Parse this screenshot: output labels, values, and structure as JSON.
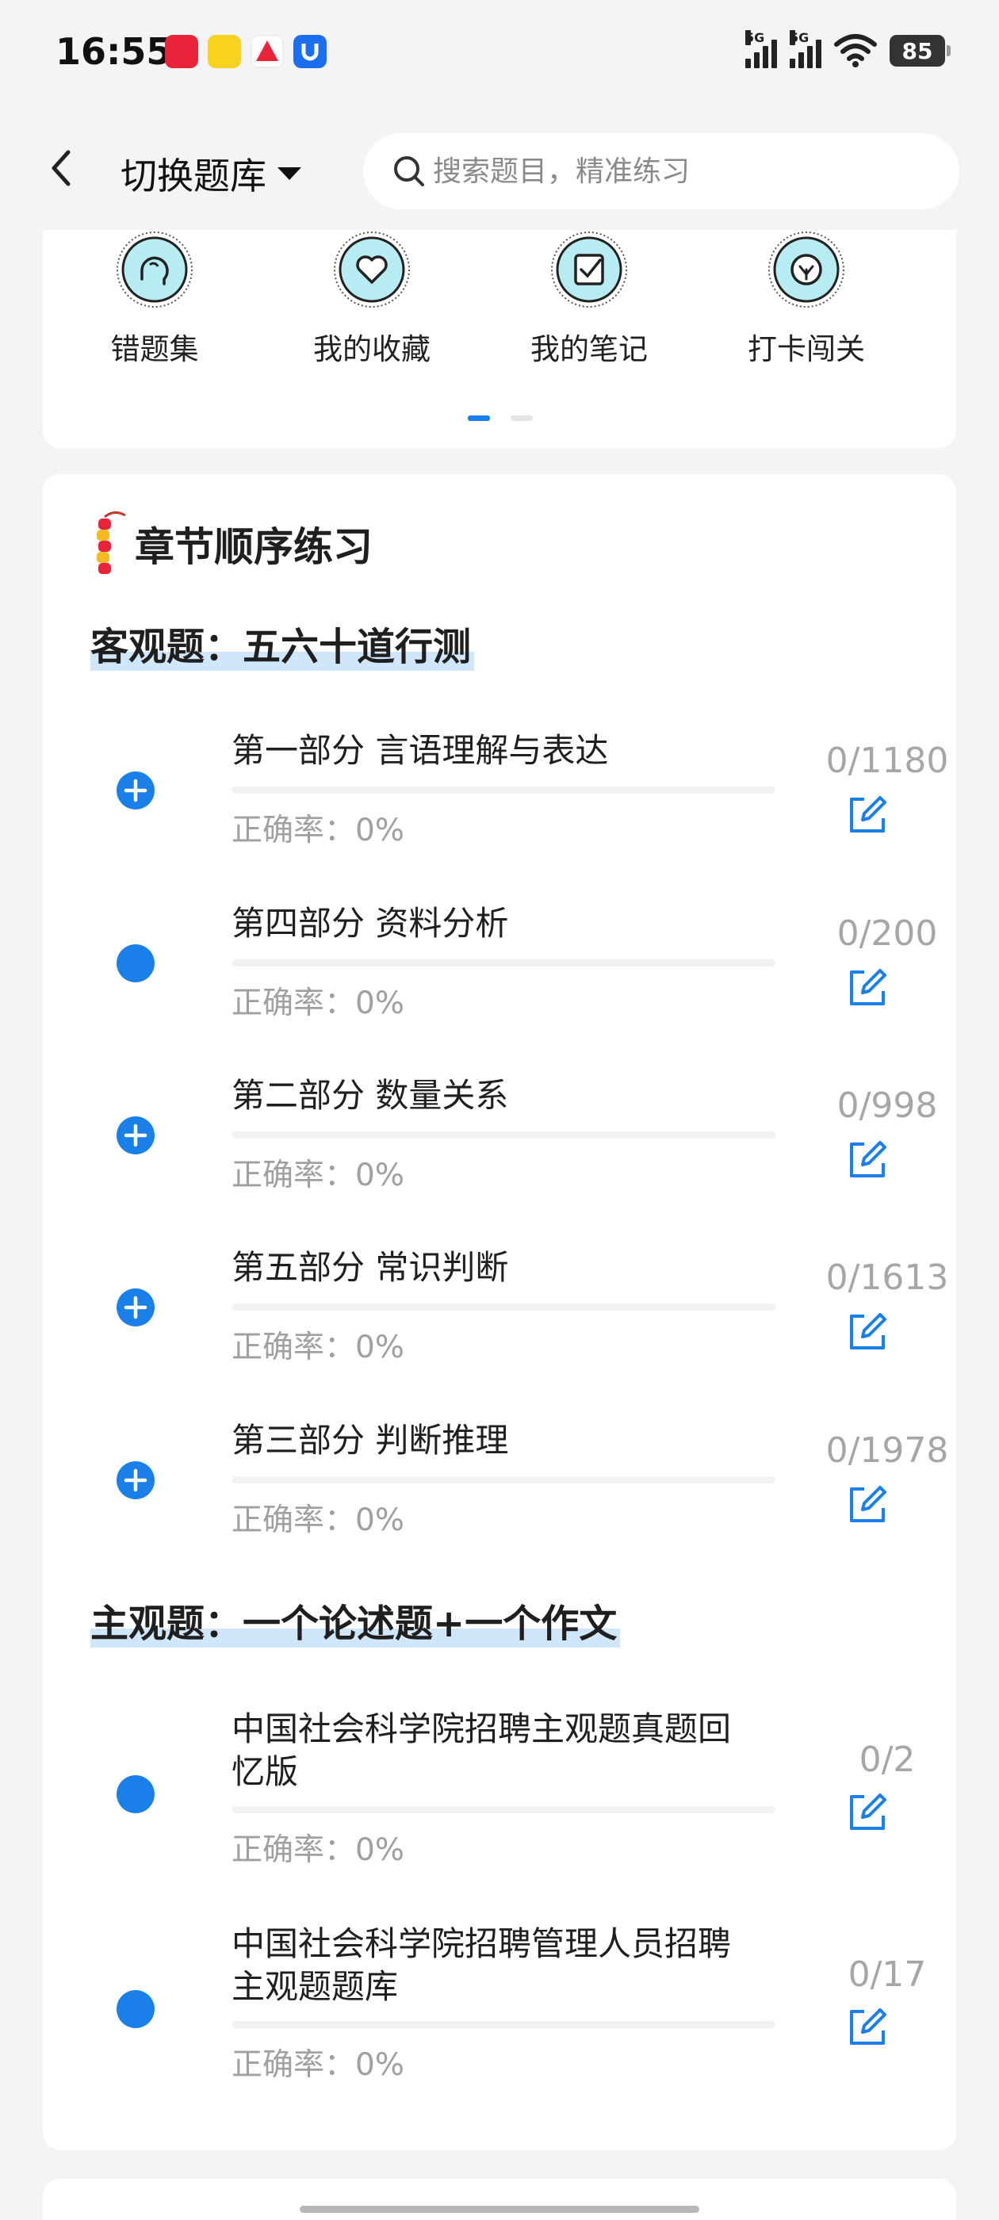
{
  "status_bar": {
    "time": "16:55",
    "signal_labels": [
      "5G",
      "5G"
    ],
    "battery": "85"
  },
  "header": {
    "switch_label": "切换题库",
    "search_placeholder": "搜索题目，精准练习"
  },
  "shortcuts": [
    {
      "label": "错题集",
      "icon": "brain-icon"
    },
    {
      "label": "我的收藏",
      "icon": "heart-icon"
    },
    {
      "label": "我的笔记",
      "icon": "note-check-icon"
    },
    {
      "label": "打卡闯关",
      "icon": "leaf-icon"
    }
  ],
  "pager": {
    "pages": 2,
    "active": 0
  },
  "practice": {
    "heading": "章节顺序练习",
    "sections": [
      {
        "title": "客观题：五六十道行测",
        "items": [
          {
            "title": "第一部分 言语理解与表达",
            "accuracy": "正确率：0%",
            "count": "0/1180",
            "bullet": "plus"
          },
          {
            "title": "第四部分 资料分析",
            "accuracy": "正确率：0%",
            "count": "0/200",
            "bullet": "dot"
          },
          {
            "title": "第二部分 数量关系",
            "accuracy": "正确率：0%",
            "count": "0/998",
            "bullet": "plus"
          },
          {
            "title": "第五部分 常识判断",
            "accuracy": "正确率：0%",
            "count": "0/1613",
            "bullet": "plus"
          },
          {
            "title": "第三部分 判断推理",
            "accuracy": "正确率：0%",
            "count": "0/1978",
            "bullet": "plus"
          }
        ]
      },
      {
        "title": "主观题：一个论述题+一个作文",
        "items": [
          {
            "title": "中国社会科学院招聘主观题真题回忆版",
            "accuracy": "正确率：0%",
            "count": "0/2",
            "bullet": "dot"
          },
          {
            "title": "中国社会科学院招聘管理人员招聘主观题题库",
            "accuracy": "正确率：0%",
            "count": "0/17",
            "bullet": "dot"
          }
        ]
      }
    ]
  },
  "colors": {
    "accent": "#1a7fe8",
    "muted": "#a0a0a0",
    "highlight": "#cfe6fb"
  }
}
